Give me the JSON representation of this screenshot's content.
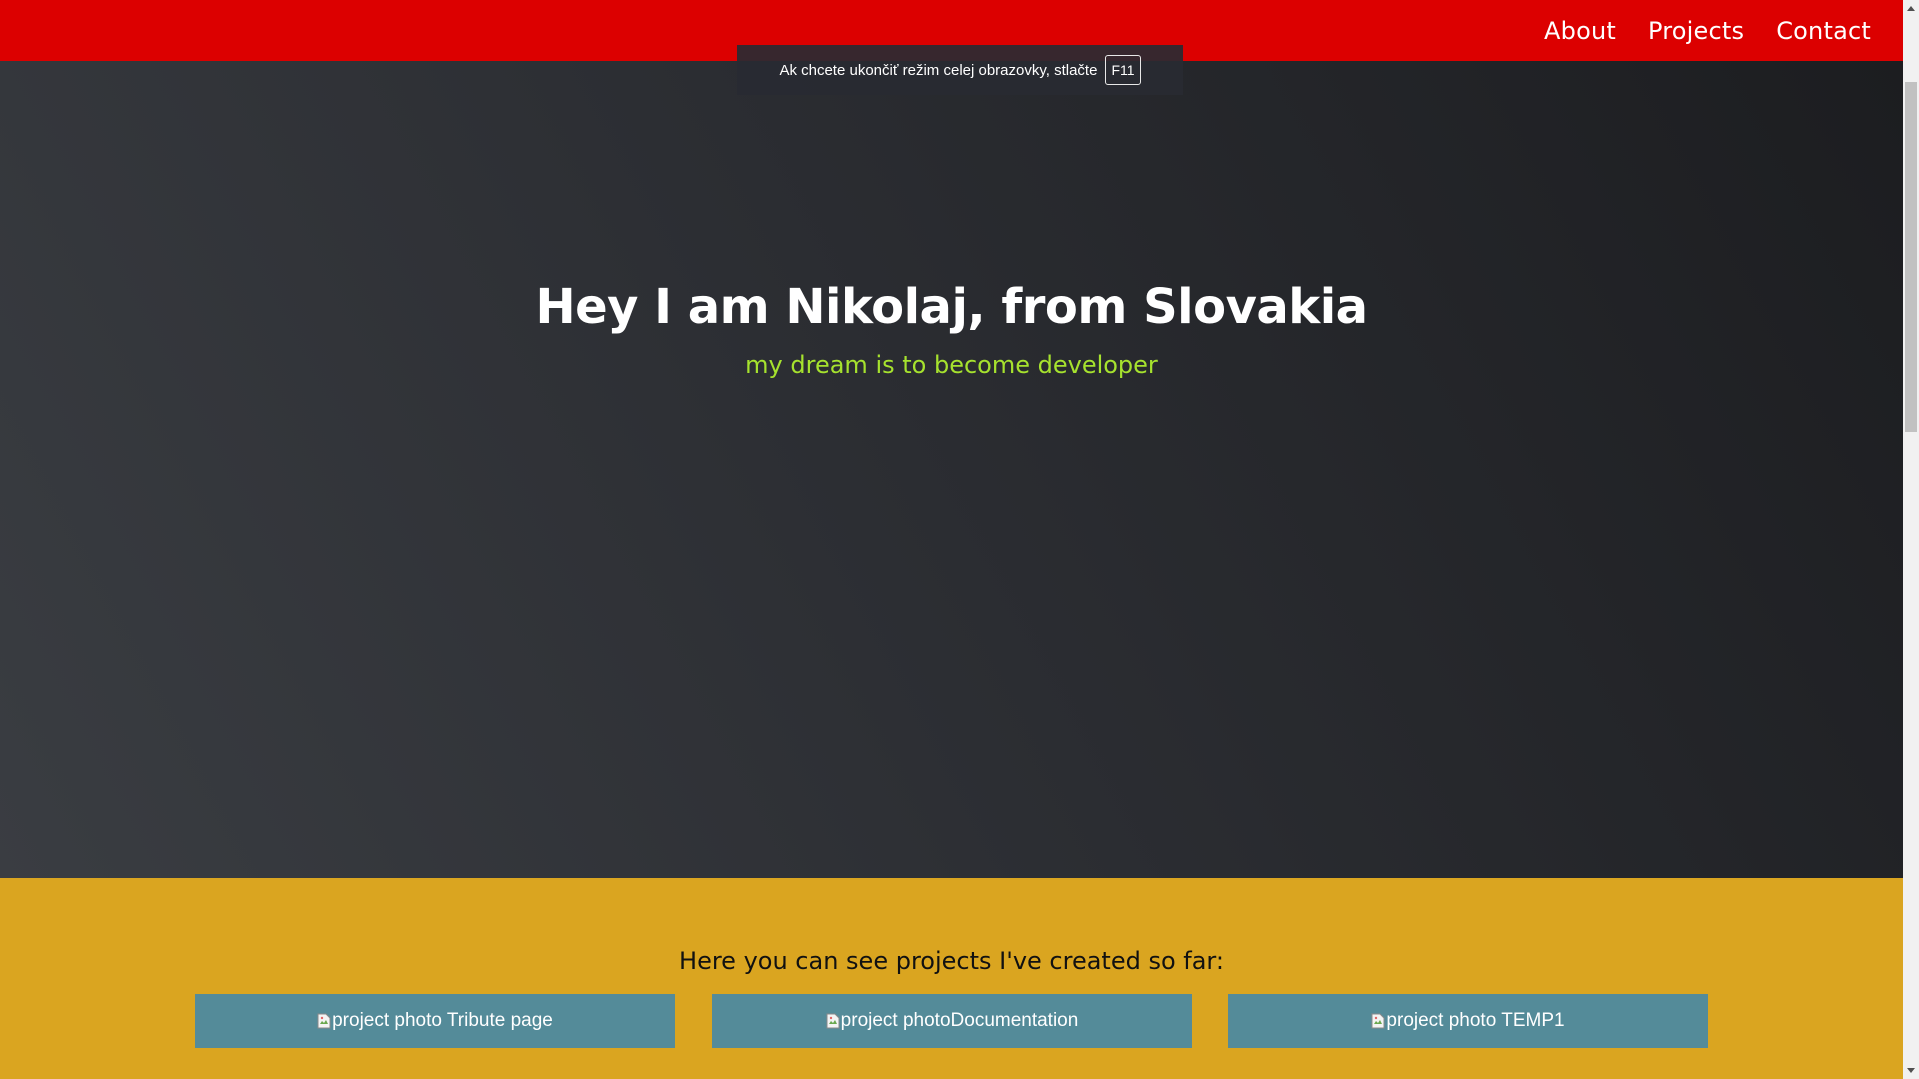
{
  "navbar": {
    "links": [
      {
        "label": "About"
      },
      {
        "label": "Projects"
      },
      {
        "label": "Contact"
      }
    ],
    "background": "#dc0000"
  },
  "fullscreen_notice": {
    "text": "Ak chcete ukončiť režim celej obrazovky, stlačte",
    "key": "F11"
  },
  "hero": {
    "title": "Hey I am Nikolaj, from Slovakia",
    "subtitle": "my dream is to become developer",
    "subtitle_color": "#a6e22e"
  },
  "projects": {
    "heading": "Here you can see projects I've created so far:",
    "background": "#daa520",
    "tile_color": "#548b99",
    "items": [
      {
        "alt_text": "project photo Tribute page"
      },
      {
        "alt_text": "project photoDocumentation"
      },
      {
        "alt_text": "project photo TEMP1"
      }
    ]
  },
  "icons": {
    "broken_image": "broken-image-icon",
    "scroll_up": "scroll-up-arrow-icon",
    "scroll_down": "scroll-down-arrow-icon"
  }
}
